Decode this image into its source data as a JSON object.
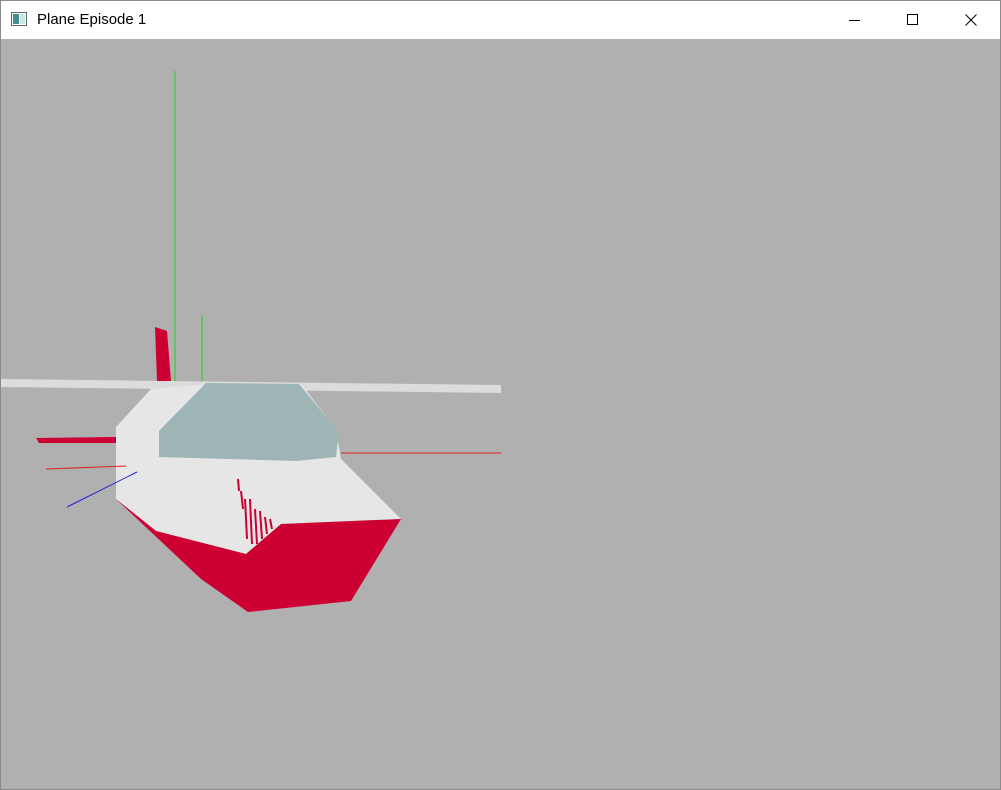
{
  "window": {
    "title": "Plane Episode 1",
    "app_icon": "app-window-icon"
  },
  "caption_buttons": {
    "minimize_icon": "minimize-icon",
    "maximize_icon": "maximize-icon",
    "close_icon": "close-icon"
  },
  "viewport": {
    "background_color": "#b0b0b0",
    "colors": {
      "body": "#e6e6e6",
      "canopy": "#9eb5b5",
      "accent": "#cc0033",
      "wing": "#dcdcdc",
      "axis_x": "#e02020",
      "axis_y": "#20d020",
      "axis_z": "#2020e0"
    }
  }
}
